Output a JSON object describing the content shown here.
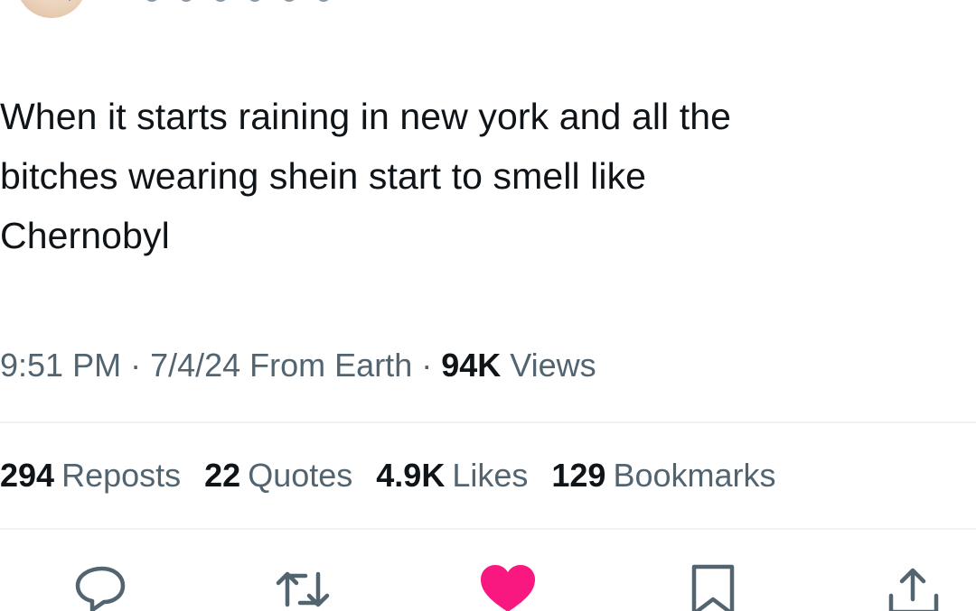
{
  "tweet": {
    "text_line1": "When it starts raining in new york and all the",
    "text_line2": "bitches wearing shein start to smell like",
    "text_line3": "Chernobyl"
  },
  "meta": {
    "time": "9:51 PM",
    "sep1": " · ",
    "date": "7/4/24",
    "source": " From Earth",
    "sep2": " · ",
    "views_count": "94K",
    "views_label": " Views"
  },
  "stats": {
    "reposts_count": "294",
    "reposts_label": "Reposts",
    "quotes_count": "22",
    "quotes_label": "Quotes",
    "likes_count": "4.9K",
    "likes_label": "Likes",
    "bookmarks_count": "129",
    "bookmarks_label": "Bookmarks"
  },
  "actions": {
    "reply_icon": "reply-icon",
    "repost_icon": "repost-icon",
    "like_icon": "heart-icon",
    "like_color": "#f91880",
    "bookmark_icon": "bookmark-icon",
    "share_icon": "share-icon",
    "icon_color": "#536471"
  }
}
